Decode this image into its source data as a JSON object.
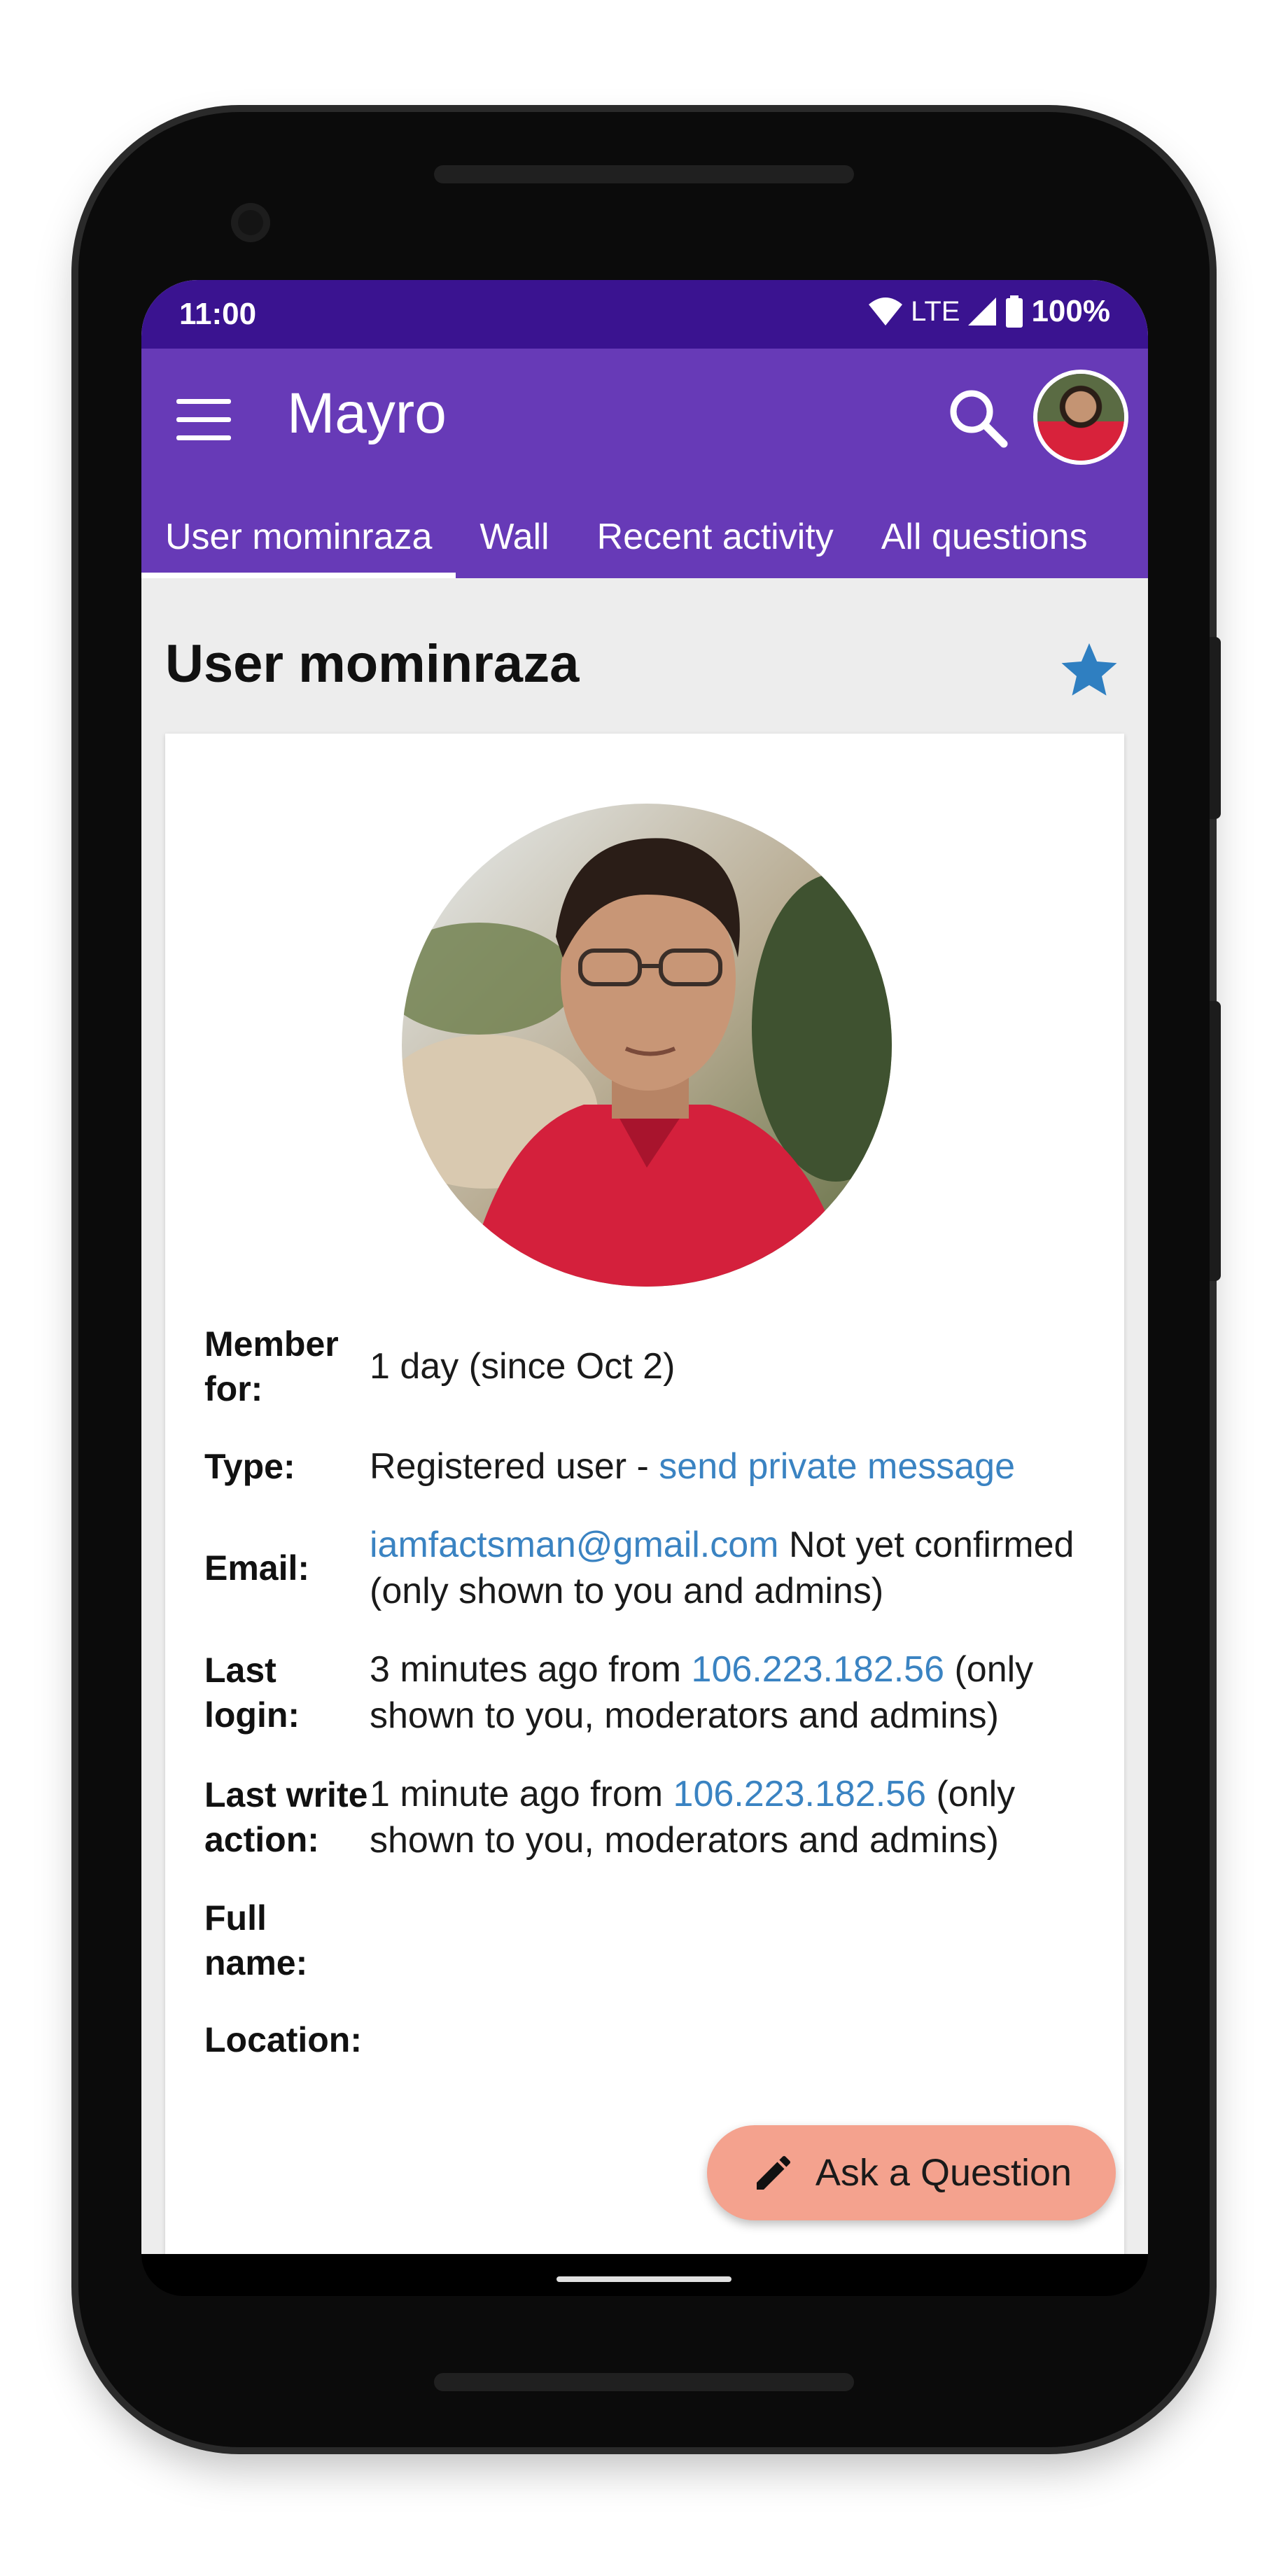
{
  "status_bar": {
    "time": "11:00",
    "network": "LTE",
    "battery": "100%"
  },
  "app_bar": {
    "title": "Mayro",
    "color": "#673ab7"
  },
  "tabs": [
    {
      "label": "User mominraza",
      "active": true
    },
    {
      "label": "Wall",
      "active": false
    },
    {
      "label": "Recent activity",
      "active": false
    },
    {
      "label": "All questions",
      "active": false
    }
  ],
  "page": {
    "heading": "User mominraza"
  },
  "profile": {
    "member_for_label": "Member for:",
    "member_for_value": "1 day (since Oct 2)",
    "type_label": "Type:",
    "type_value": "Registered user - ",
    "type_link": "send private message",
    "email_label": "Email:",
    "email_link": "iamfactsman@gmail.com",
    "email_note": " Not yet confirmed (only shown to you and admins)",
    "last_login_label": "Last login:",
    "last_login_prefix": "3 minutes ago from ",
    "last_login_ip": "106.223.182.56",
    "last_login_note": " (only shown to you, moderators and admins)",
    "last_write_label": "Last write action:",
    "last_write_prefix": "1 minute ago from ",
    "last_write_ip": "106.223.182.56",
    "last_write_note": " (only shown to you, moderators and admins)",
    "full_name_label": "Full name:",
    "location_label": "Location:"
  },
  "fab": {
    "label": "Ask a Question",
    "color": "#f4a28e"
  },
  "icons": {
    "menu": "menu-icon",
    "search": "search-icon",
    "star": "star-icon",
    "pencil": "pencil-icon"
  }
}
